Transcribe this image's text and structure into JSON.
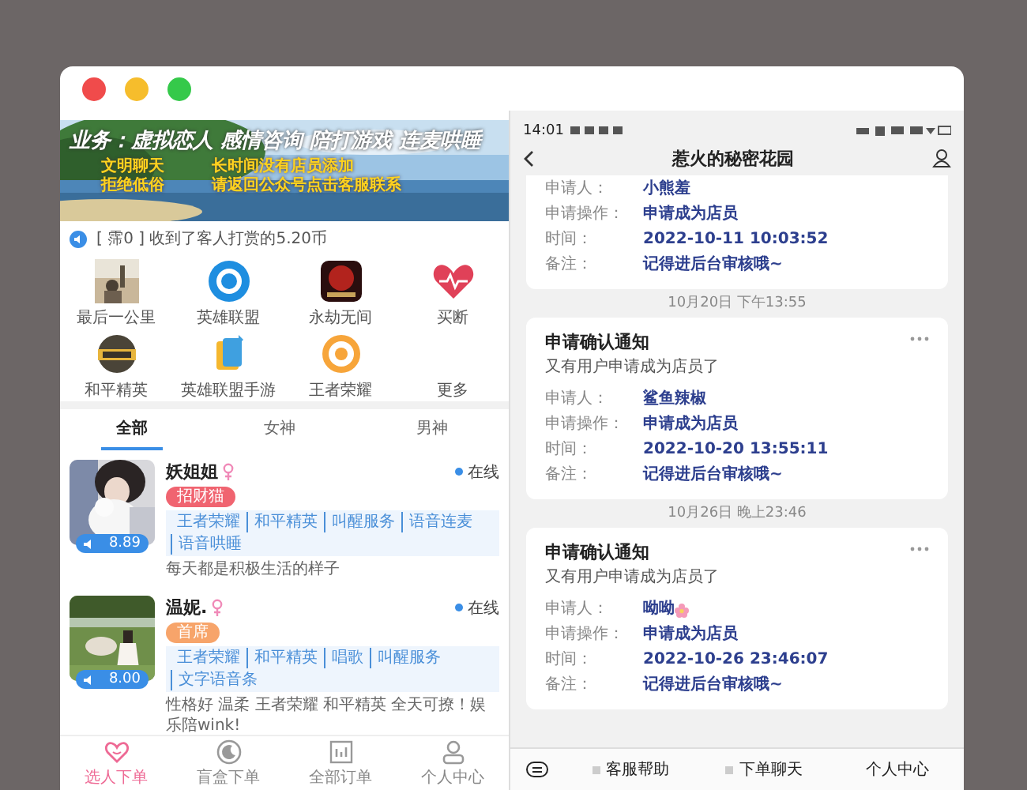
{
  "window": {
    "traffic_lights": [
      {
        "color": "#f04b4b"
      },
      {
        "color": "#f6bd2c"
      },
      {
        "color": "#35c94a"
      }
    ]
  },
  "left_app": {
    "banner": {
      "kind": "picture",
      "headline": "业务：虚拟恋人 感情咨询 陪打游戏 连麦哄睡",
      "left_lines": [
        "文明聊天",
        "拒绝低俗"
      ],
      "right_lines": [
        "长时间没有店员添加",
        "请返回公众号点击客服联系"
      ]
    },
    "notice": "[ 霈0 ] 收到了客人打赏的5.20币",
    "categories": [
      {
        "label": "最后一公里"
      },
      {
        "kind": "circle-logo",
        "label": "英雄联盟"
      },
      {
        "kind": "game-tile",
        "label": "永劫无间"
      },
      {
        "kind": "heart",
        "label": "买断"
      },
      {
        "kind": "badge-logo",
        "label": "和平精英"
      },
      {
        "kind": "book",
        "label": "英雄联盟手游"
      },
      {
        "kind": "target",
        "label": "王者荣耀"
      },
      {
        "kind": "none",
        "label": "更多"
      }
    ],
    "tabs": [
      {
        "label": "全部",
        "selected": true
      },
      {
        "label": "女神",
        "selected": false
      },
      {
        "label": "男神",
        "selected": false
      }
    ],
    "companions": [
      {
        "name": "妖姐姐",
        "badge": {
          "text": "招财猫",
          "color": "#f06470"
        },
        "status": "在线",
        "online": true,
        "price": "8.89",
        "skills": [
          "王者荣耀",
          "和平精英",
          "叫醒服务",
          "语音连麦",
          "语音哄睡"
        ],
        "bio": "每天都是积极生活的样子"
      },
      {
        "name": "温妮.",
        "badge": {
          "text": "首席",
          "color": "#f7a46a"
        },
        "status": "在线",
        "online": true,
        "price": "8.00",
        "skills": [
          "王者荣耀",
          "和平精英",
          "唱歌",
          "叫醒服务",
          "文字语音条"
        ],
        "bio": "性格好 温柔 王者荣耀 和平精英 全天可撩！娱乐陪wink!"
      }
    ],
    "nav": [
      {
        "kind": "heart",
        "label": "选人下单",
        "selected": true
      },
      {
        "kind": "moon",
        "label": "盲盒下单",
        "selected": false
      },
      {
        "kind": "chart",
        "label": "全部订单",
        "selected": false
      },
      {
        "kind": "person",
        "label": "个人中心",
        "selected": false
      }
    ]
  },
  "right_app": {
    "time": "14:01",
    "title": "惹火的秘密花园",
    "messages": [
      {
        "kind": "card",
        "cut": true,
        "rows": [
          {
            "label": "申请人：",
            "value": "小熊羞"
          },
          {
            "label": "申请操作：",
            "value": "申请成为店员"
          },
          {
            "label": "时间：",
            "value": "2022-10-11 10:03:52"
          },
          {
            "label": "备注：",
            "value": "记得进后台审核哦~"
          }
        ]
      },
      {
        "kind": "time",
        "text": "10月20日 下午13:55"
      },
      {
        "kind": "card",
        "cut": false,
        "title": "申请确认通知",
        "subtitle": "又有用户申请成为店员了",
        "rows": [
          {
            "label": "申请人：",
            "value": "鲨鱼辣椒"
          },
          {
            "label": "申请操作：",
            "value": "申请成为店员"
          },
          {
            "label": "时间：",
            "value": "2022-10-20 13:55:11"
          },
          {
            "label": "备注：",
            "value": "记得进后台审核哦~"
          }
        ]
      },
      {
        "kind": "time",
        "text": "10月26日 晚上23:46"
      },
      {
        "kind": "card",
        "cut": false,
        "title": "申请确认通知",
        "subtitle": "又有用户申请成为店员了",
        "rows": [
          {
            "label": "申请人：",
            "value": "呦呦",
            "flower": true
          },
          {
            "label": "申请操作：",
            "value": "申请成为店员"
          },
          {
            "label": "时间：",
            "value": "2022-10-26 23:46:07"
          },
          {
            "label": "备注：",
            "value": "记得进后台审核哦~"
          }
        ]
      }
    ],
    "menu": [
      "客服帮助",
      "下单聊天",
      "个人中心"
    ]
  }
}
